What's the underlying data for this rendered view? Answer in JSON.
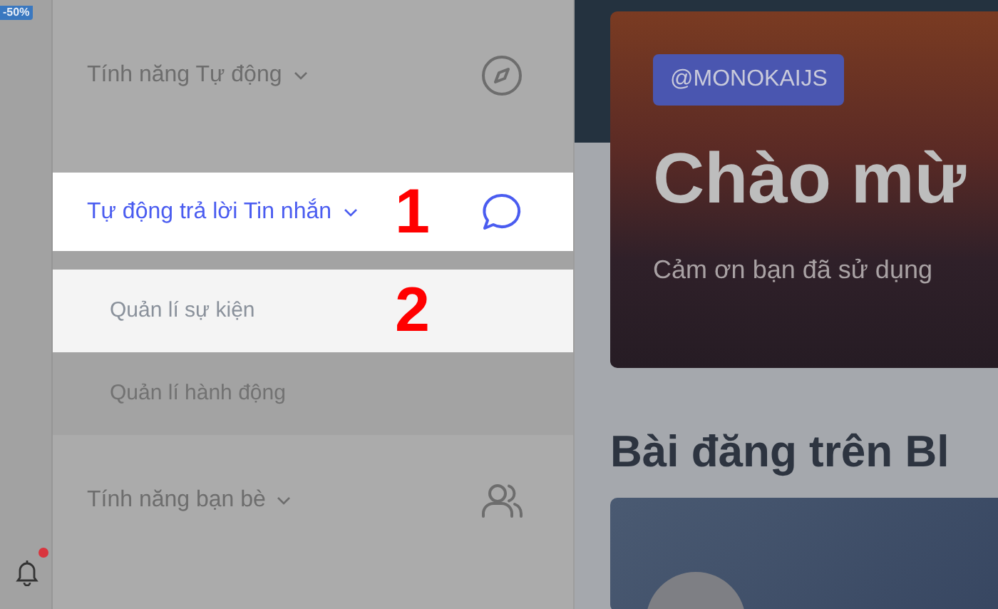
{
  "rail": {
    "promo_badge": "-50%",
    "notification": true
  },
  "sidebar": {
    "groups": [
      {
        "label": "Tính năng Tự động",
        "selected": false,
        "highlighted": false,
        "children": [
          {
            "label": "Tự động trả lời Tin nhắn",
            "selected": true,
            "highlighted": true,
            "callout": "1",
            "children": [
              {
                "label": "Quản lí sự kiện",
                "selected": false,
                "highlighted": true,
                "callout": "2"
              },
              {
                "label": "Quản lí hành động",
                "selected": false,
                "highlighted": false
              }
            ]
          }
        ]
      },
      {
        "label": "Tính năng bạn bè",
        "selected": false,
        "highlighted": false
      }
    ]
  },
  "hero": {
    "tag": "@MONOKAIJS",
    "title": "Chào mừ",
    "subtitle": "Cảm ơn bạn đã sử dụng"
  },
  "section": {
    "heading": "Bài đăng trên Bl"
  }
}
